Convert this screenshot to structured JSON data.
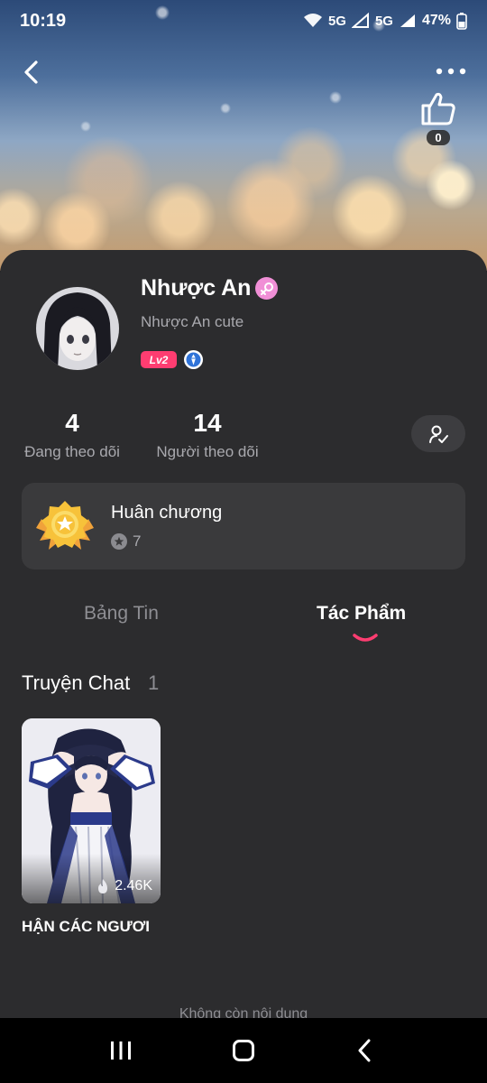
{
  "status_bar": {
    "time": "10:19",
    "network_1": "5G",
    "network_2": "5G",
    "battery": "47%"
  },
  "header": {
    "like_count": "0",
    "icons": [
      "back-arrow-icon",
      "more-dots-icon",
      "thumbs-up-icon"
    ]
  },
  "profile": {
    "name": "Nhược An",
    "bio": "Nhược An cute",
    "level": "Lv2",
    "gender_color": "#f08fd6"
  },
  "stats": {
    "following_count": "4",
    "following_label": "Đang theo dõi",
    "followers_count": "14",
    "followers_label": "Người theo dõi"
  },
  "medal": {
    "title": "Huân chương",
    "count": "7"
  },
  "tabs": [
    {
      "label": "Bảng Tin",
      "active": false
    },
    {
      "label": "Tác Phẩm",
      "active": true
    }
  ],
  "section": {
    "title": "Truyện Chat",
    "count": "1"
  },
  "stories": [
    {
      "title": "HẬN CÁC NGƯƠI",
      "views": "2.46K"
    }
  ],
  "end_text": "Không còn nội dung",
  "colors": {
    "accent": "#ff3d71",
    "background": "#2c2c2e",
    "card": "#3a3a3c"
  }
}
